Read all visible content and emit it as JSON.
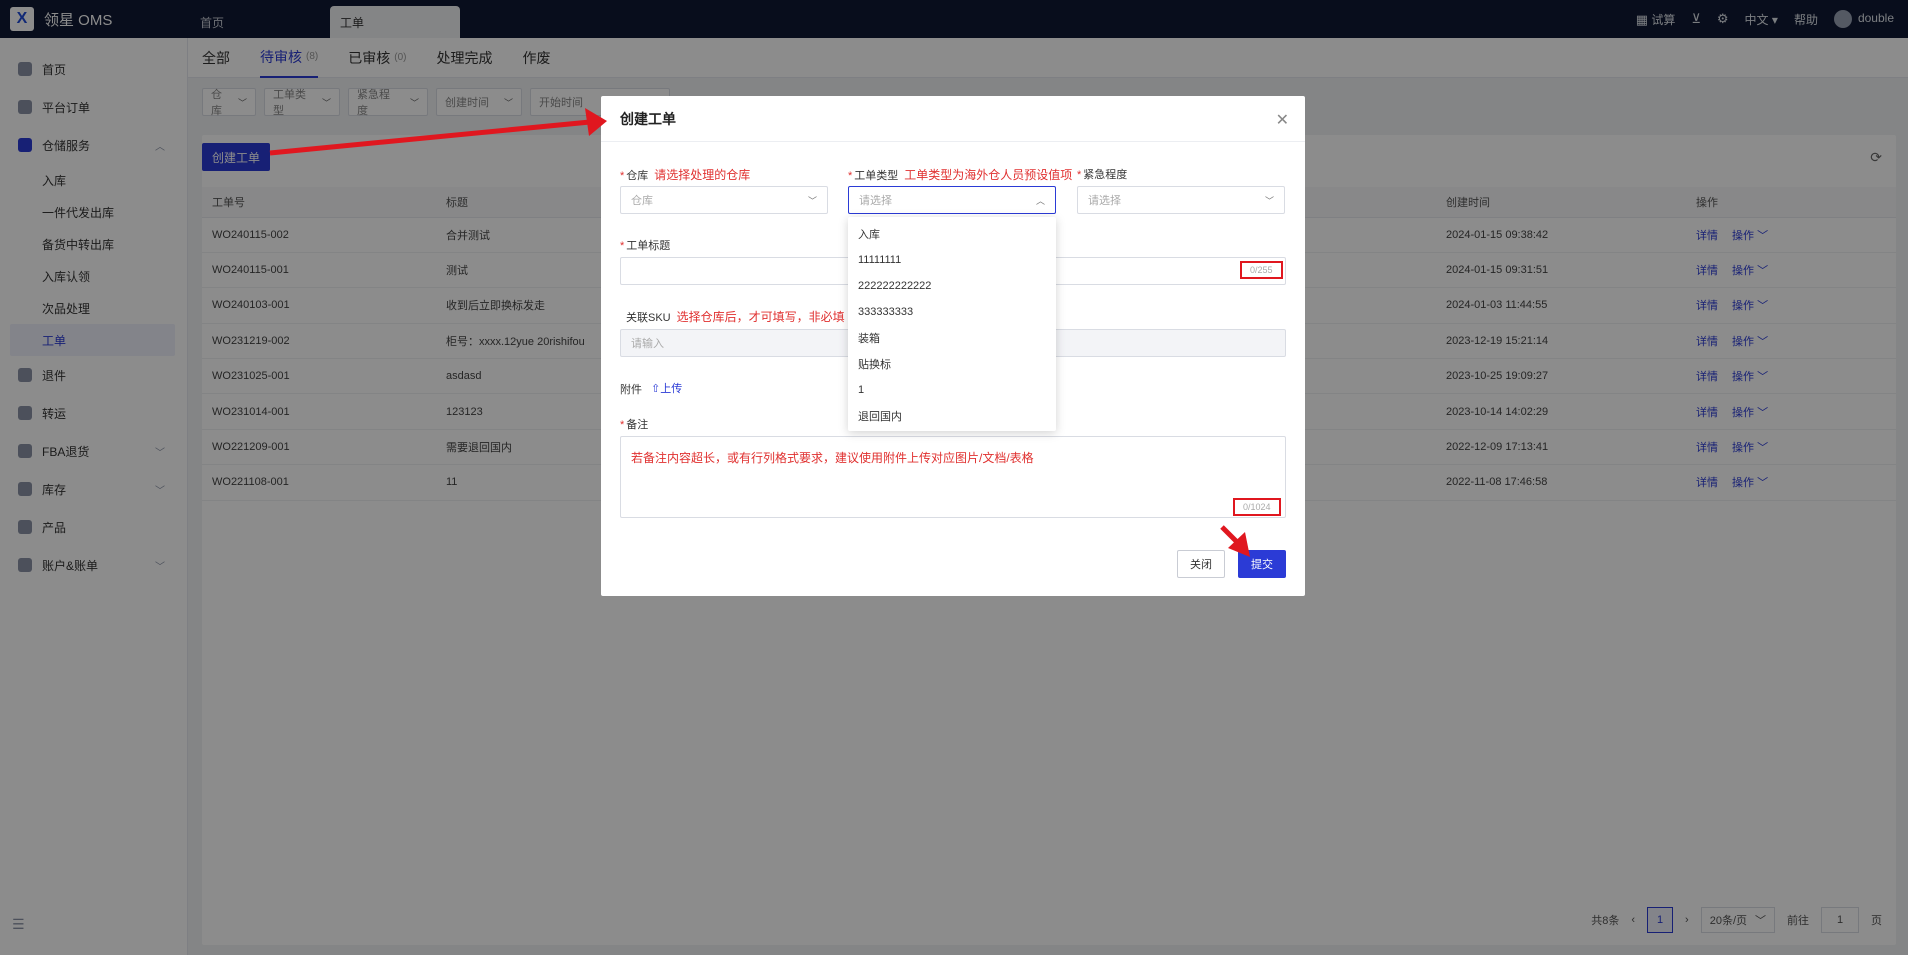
{
  "app": {
    "logo_letter": "X",
    "title": "领星 OMS"
  },
  "top_tabs": [
    {
      "label": "首页"
    },
    {
      "label": "工单"
    }
  ],
  "top_right": {
    "trial": "试算",
    "lang": "中文",
    "help": "帮助",
    "user": "double"
  },
  "sidebar": {
    "items": [
      {
        "label": "首页"
      },
      {
        "label": "平台订单"
      },
      {
        "label": "仓储服务"
      },
      {
        "label": "退件"
      },
      {
        "label": "转运"
      },
      {
        "label": "FBA退货"
      },
      {
        "label": "库存"
      },
      {
        "label": "产品"
      },
      {
        "label": "账户&账单"
      }
    ],
    "sub_items": [
      {
        "label": "入库"
      },
      {
        "label": "一件代发出库"
      },
      {
        "label": "备货中转出库"
      },
      {
        "label": "入库认领"
      },
      {
        "label": "次品处理"
      },
      {
        "label": "工单"
      }
    ]
  },
  "subtabs": [
    {
      "label": "全部",
      "count": ""
    },
    {
      "label": "待审核",
      "count": "(8)"
    },
    {
      "label": "已审核",
      "count": "(0)"
    },
    {
      "label": "处理完成",
      "count": ""
    },
    {
      "label": "作废",
      "count": ""
    }
  ],
  "filters": [
    {
      "label": "仓库"
    },
    {
      "label": "工单类型"
    },
    {
      "label": "紧急程度"
    },
    {
      "label": "创建时间"
    },
    {
      "label": "开始时间"
    }
  ],
  "list": {
    "create_label": "创建工单",
    "headers": {
      "no": "工单号",
      "title": "标题",
      "created": "创建时间",
      "ops": "操作"
    },
    "rows": [
      {
        "no": "WO240115-002",
        "title": "合并测试",
        "created": "2024-01-15 09:38:42"
      },
      {
        "no": "WO240115-001",
        "title": "测试",
        "created": "2024-01-15 09:31:51"
      },
      {
        "no": "WO240103-001",
        "title": "收到后立即换标发走",
        "created": "2024-01-03 11:44:55"
      },
      {
        "no": "WO231219-002",
        "title": "柜号：xxxx.12yue 20rishifou",
        "created": "2023-12-19 15:21:14"
      },
      {
        "no": "WO231025-001",
        "title": "asdasd",
        "created": "2023-10-25 19:09:27"
      },
      {
        "no": "WO231014-001",
        "title": "123123",
        "created": "2023-10-14 14:02:29"
      },
      {
        "no": "WO221209-001",
        "title": "需要退回国内",
        "created": "2022-12-09 17:13:41"
      },
      {
        "no": "WO221108-001",
        "title": "11",
        "created": "2022-11-08 17:46:58"
      }
    ],
    "op_detail": "详情",
    "op_action": "操作"
  },
  "pager": {
    "total": "共8条",
    "page": "1",
    "size": "20条/页",
    "goto": "前往",
    "goto_value": "1",
    "page_unit": "页"
  },
  "modal": {
    "title": "创建工单",
    "warehouse_label": "仓库",
    "warehouse_note": "请选择处理的仓库",
    "warehouse_placeholder": "仓库",
    "type_label": "工单类型",
    "type_note": "工单类型为海外仓人员预设值项",
    "type_placeholder": "请选择",
    "urgency_label": "紧急程度",
    "urgency_placeholder": "请选择",
    "title_label": "工单标题",
    "title_counter": "0/255",
    "sku_label": "关联SKU",
    "sku_note": "选择仓库后，才可填写，非必填",
    "sku_placeholder": "请输入",
    "attach_label": "附件",
    "upload_label": "上传",
    "remark_label": "备注",
    "remark_note": "若备注内容超长，或有行列格式要求，建议使用附件上传对应图片/文档/表格",
    "remark_counter": "0/1024",
    "close_label": "关闭",
    "submit_label": "提交"
  },
  "dropdown": {
    "options": [
      "入库",
      "11111111",
      "222222222222",
      "333333333",
      "装箱",
      "贴换标",
      "1",
      "退回国内"
    ]
  },
  "colors": {
    "primary": "#2b3bd6",
    "topbar": "#0f1934",
    "annotation": "#e0171f"
  }
}
